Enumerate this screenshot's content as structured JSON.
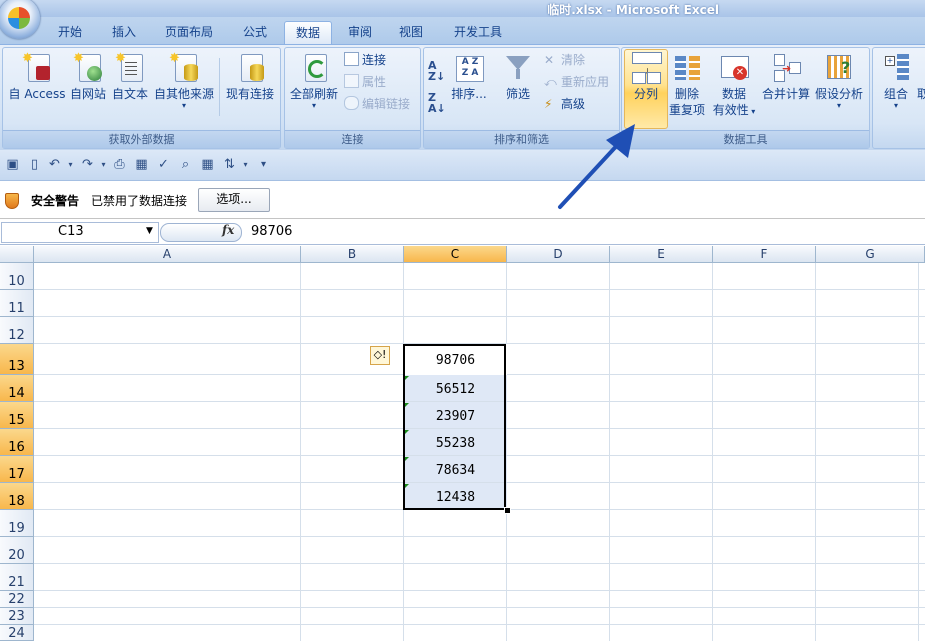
{
  "window": {
    "title": "临时.xlsx - Microsoft Excel"
  },
  "tabs": [
    "开始",
    "插入",
    "页面布局",
    "公式",
    "数据",
    "审阅",
    "视图",
    "开发工具"
  ],
  "active_tab": "数据",
  "ribbon": {
    "get_external": {
      "label": "获取外部数据",
      "buttons": [
        "自 Access",
        "自网站",
        "自文本",
        "自其他来源",
        "现有连接"
      ]
    },
    "connections": {
      "label": "连接",
      "refresh_all": "全部刷新",
      "items": [
        "连接",
        "属性",
        "编辑链接"
      ]
    },
    "sort_filter": {
      "label": "排序和筛选",
      "sort": "排序...",
      "filter": "筛选",
      "items": [
        "清除",
        "重新应用",
        "高级"
      ]
    },
    "data_tools": {
      "label": "数据工具",
      "split": "分列",
      "remove_dup_1": "删除",
      "remove_dup_2": "重复项",
      "validation_1": "数据",
      "validation_2": "有效性",
      "consolidate": "合并计算",
      "whatif": "假设分析"
    },
    "outline": {
      "group": "组合",
      "ungroup_partial": "取"
    }
  },
  "security_bar": {
    "title": "安全警告",
    "message": "已禁用了数据连接",
    "options_button": "选项..."
  },
  "formula_bar": {
    "name_box": "C13",
    "fx": "fx",
    "value": "98706"
  },
  "columns": [
    "A",
    "B",
    "C",
    "D",
    "E",
    "F",
    "G"
  ],
  "rows": [
    "10",
    "11",
    "12",
    "13",
    "14",
    "15",
    "16",
    "17",
    "18",
    "19",
    "20",
    "21",
    "22",
    "23",
    "24"
  ],
  "cells_C": [
    "98706",
    "56512",
    "23907",
    "55238",
    "78634",
    "12438"
  ],
  "colors": {
    "selection_header": "#f8b74c",
    "accent": "#15428b",
    "arrow": "#1f4fb5"
  }
}
